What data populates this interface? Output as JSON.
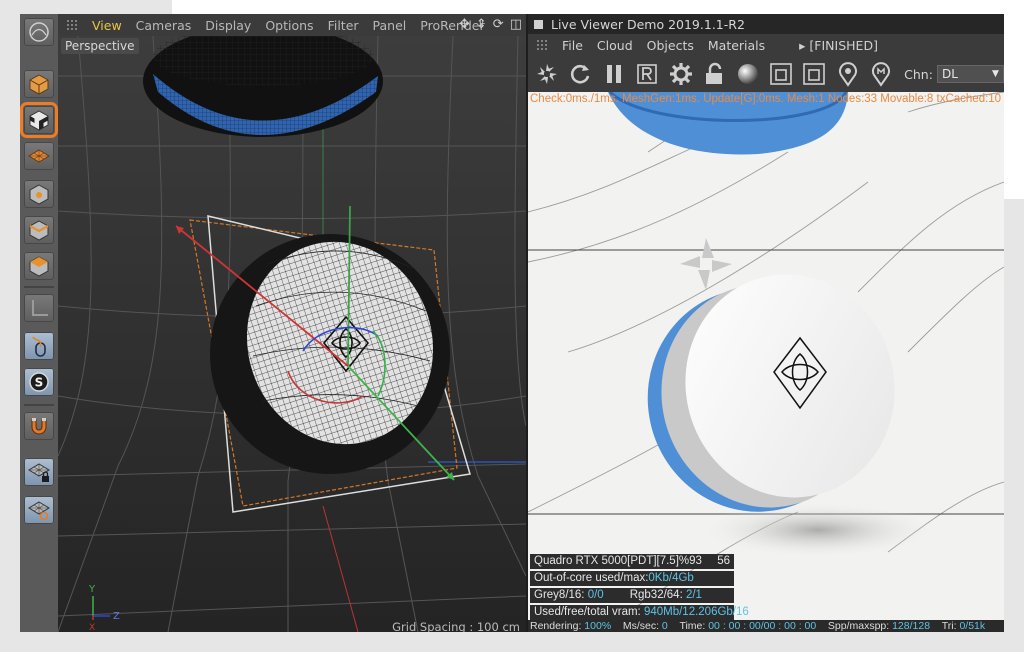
{
  "viewport": {
    "menu": [
      "View",
      "Cameras",
      "Display",
      "Options",
      "Filter",
      "Panel",
      "ProRender"
    ],
    "active_menu": "View",
    "camera_label": "Perspective",
    "footer": "Grid Spacing : 100 cm",
    "axes": {
      "y": "Y",
      "z": "Z",
      "x": "X"
    }
  },
  "palette": {
    "tools": [
      {
        "name": "model-tool-icon"
      },
      {
        "name": "object-mode-icon"
      },
      {
        "name": "texture-mode-icon",
        "selected": true
      },
      {
        "name": "workplane-icon"
      },
      {
        "name": "points-mode-icon"
      },
      {
        "name": "edges-mode-icon"
      },
      {
        "name": "polygons-mode-icon"
      },
      {
        "name": "axis-mode-icon"
      },
      {
        "name": "tweak-mode-icon"
      },
      {
        "name": "solo-icon"
      },
      {
        "name": "snap-magnet-icon"
      },
      {
        "name": "locked-workplane-icon"
      },
      {
        "name": "planar-workplane-icon"
      }
    ],
    "solo_letter": "S"
  },
  "viewer": {
    "title": "Live Viewer Demo 2019.1.1-R2",
    "menu": [
      "File",
      "Cloud",
      "Objects",
      "Materials"
    ],
    "status": "[FINISHED]",
    "chn_label": "Chn:",
    "chn_value": "DL",
    "check_line": "Check:0ms./1ms. MeshGen:1ms. Update[G]:0ms. Mesh:1 Nodes:33 Movable:8 txCached:10",
    "stats": {
      "gpu": "Quadro RTX 5000[PDT][7.5]%93",
      "gpu_value": "56",
      "ooc_label": "Out-of-core used/max:",
      "ooc_value": "0Kb/4Gb",
      "grey_label": "Grey8/16: ",
      "grey_value": "0/0",
      "rgb_label": "Rgb32/64: ",
      "rgb_value": "2/1",
      "vram_label": "Used/free/total vram: ",
      "vram_value": "940Mb/12.206Gb/16"
    },
    "statusbar": {
      "rendering_label": "Rendering: ",
      "rendering_value": "100%",
      "ms_label": "Ms/sec: ",
      "ms_value": "0",
      "time_label": "Time: ",
      "time_value": "00 : 00 : 00/00 : 00 : 00",
      "spp_label": "Spp/maxspp: ",
      "spp_value": "128/128",
      "tri_label": "Tri: ",
      "tri_value": "0/51k"
    }
  },
  "colors": {
    "accent_orange": "#ed7c24",
    "active_menu": "#e9c547",
    "value_cyan": "#5ec3e6",
    "object_blue": "#4f8fd6"
  }
}
